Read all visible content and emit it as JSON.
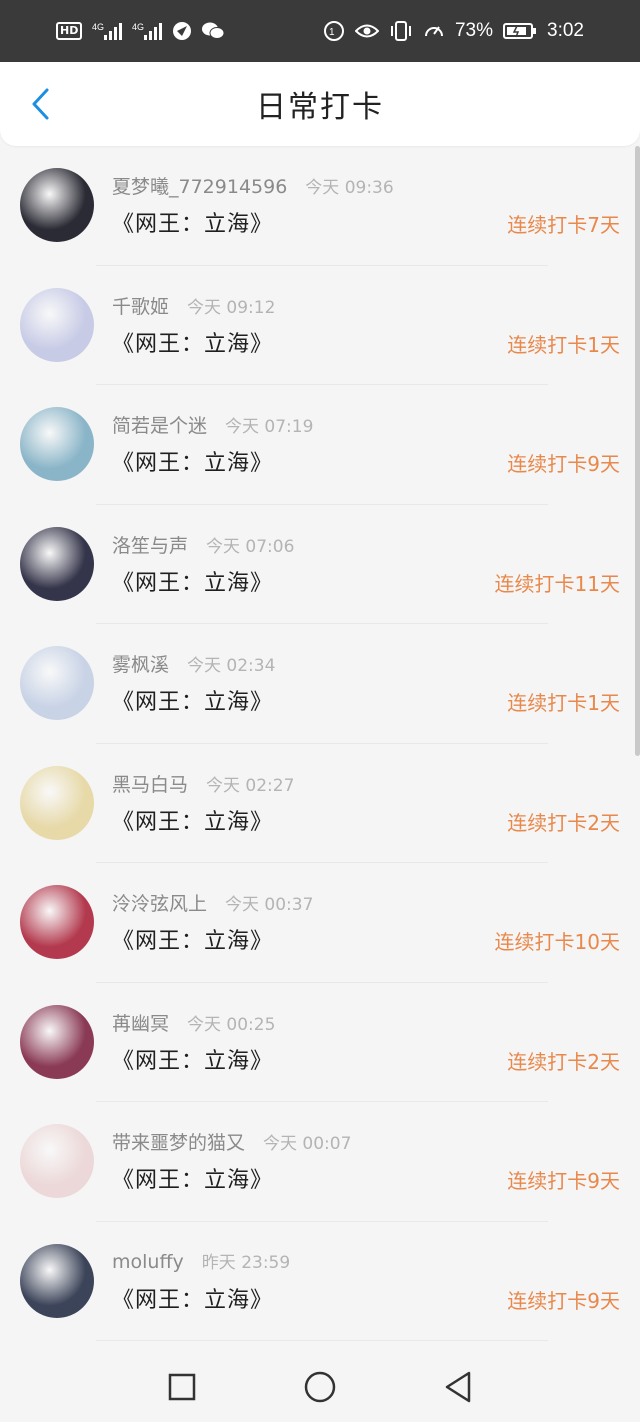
{
  "status_bar": {
    "left_icons": [
      "hd-icon",
      "4g-signal-icon",
      "4g-signal-icon",
      "app-icon",
      "wechat-icon"
    ],
    "battery_percent": "73%",
    "time": "3:02"
  },
  "header": {
    "title": "日常打卡",
    "back_icon": "chevron-left-icon"
  },
  "colors": {
    "accent": "#1d8fe1",
    "streak": "#e9884b",
    "username": "#8a8a8a",
    "timestamp": "#b4b4b4"
  },
  "items": [
    {
      "username": "夏梦曦_772914596",
      "time": "今天 09:36",
      "title": "《网王：立海》",
      "streak": "连续打卡7天",
      "avatar_color": "#2b2b35"
    },
    {
      "username": "千歌姬",
      "time": "今天 09:12",
      "title": "《网王：立海》",
      "streak": "连续打卡1天",
      "avatar_color": "#c7cbe6"
    },
    {
      "username": "简若是个迷",
      "time": "今天 07:19",
      "title": "《网王：立海》",
      "streak": "连续打卡9天",
      "avatar_color": "#8ab5c8"
    },
    {
      "username": "洛笙与声",
      "time": "今天 07:06",
      "title": "《网王：立海》",
      "streak": "连续打卡11天",
      "avatar_color": "#34344a"
    },
    {
      "username": "雾枫溪",
      "time": "今天 02:34",
      "title": "《网王：立海》",
      "streak": "连续打卡1天",
      "avatar_color": "#c8d3e6"
    },
    {
      "username": "黑马白马",
      "time": "今天 02:27",
      "title": "《网王：立海》",
      "streak": "连续打卡2天",
      "avatar_color": "#e7d9a8"
    },
    {
      "username": "泠泠弦风上",
      "time": "今天 00:37",
      "title": "《网王：立海》",
      "streak": "连续打卡10天",
      "avatar_color": "#b33a4e"
    },
    {
      "username": "苒幽冥",
      "time": "今天 00:25",
      "title": "《网王：立海》",
      "streak": "连续打卡2天",
      "avatar_color": "#8a3a55"
    },
    {
      "username": "带来噩梦的猫又",
      "time": "今天 00:07",
      "title": "《网王：立海》",
      "streak": "连续打卡9天",
      "avatar_color": "#ecd8d8"
    },
    {
      "username": "moluffy",
      "time": "昨天 23:59",
      "title": "《网王：立海》",
      "streak": "连续打卡9天",
      "avatar_color": "#3c4459"
    }
  ],
  "nav_bar": {
    "icons": [
      "recent-apps-icon",
      "home-icon",
      "back-icon"
    ]
  }
}
